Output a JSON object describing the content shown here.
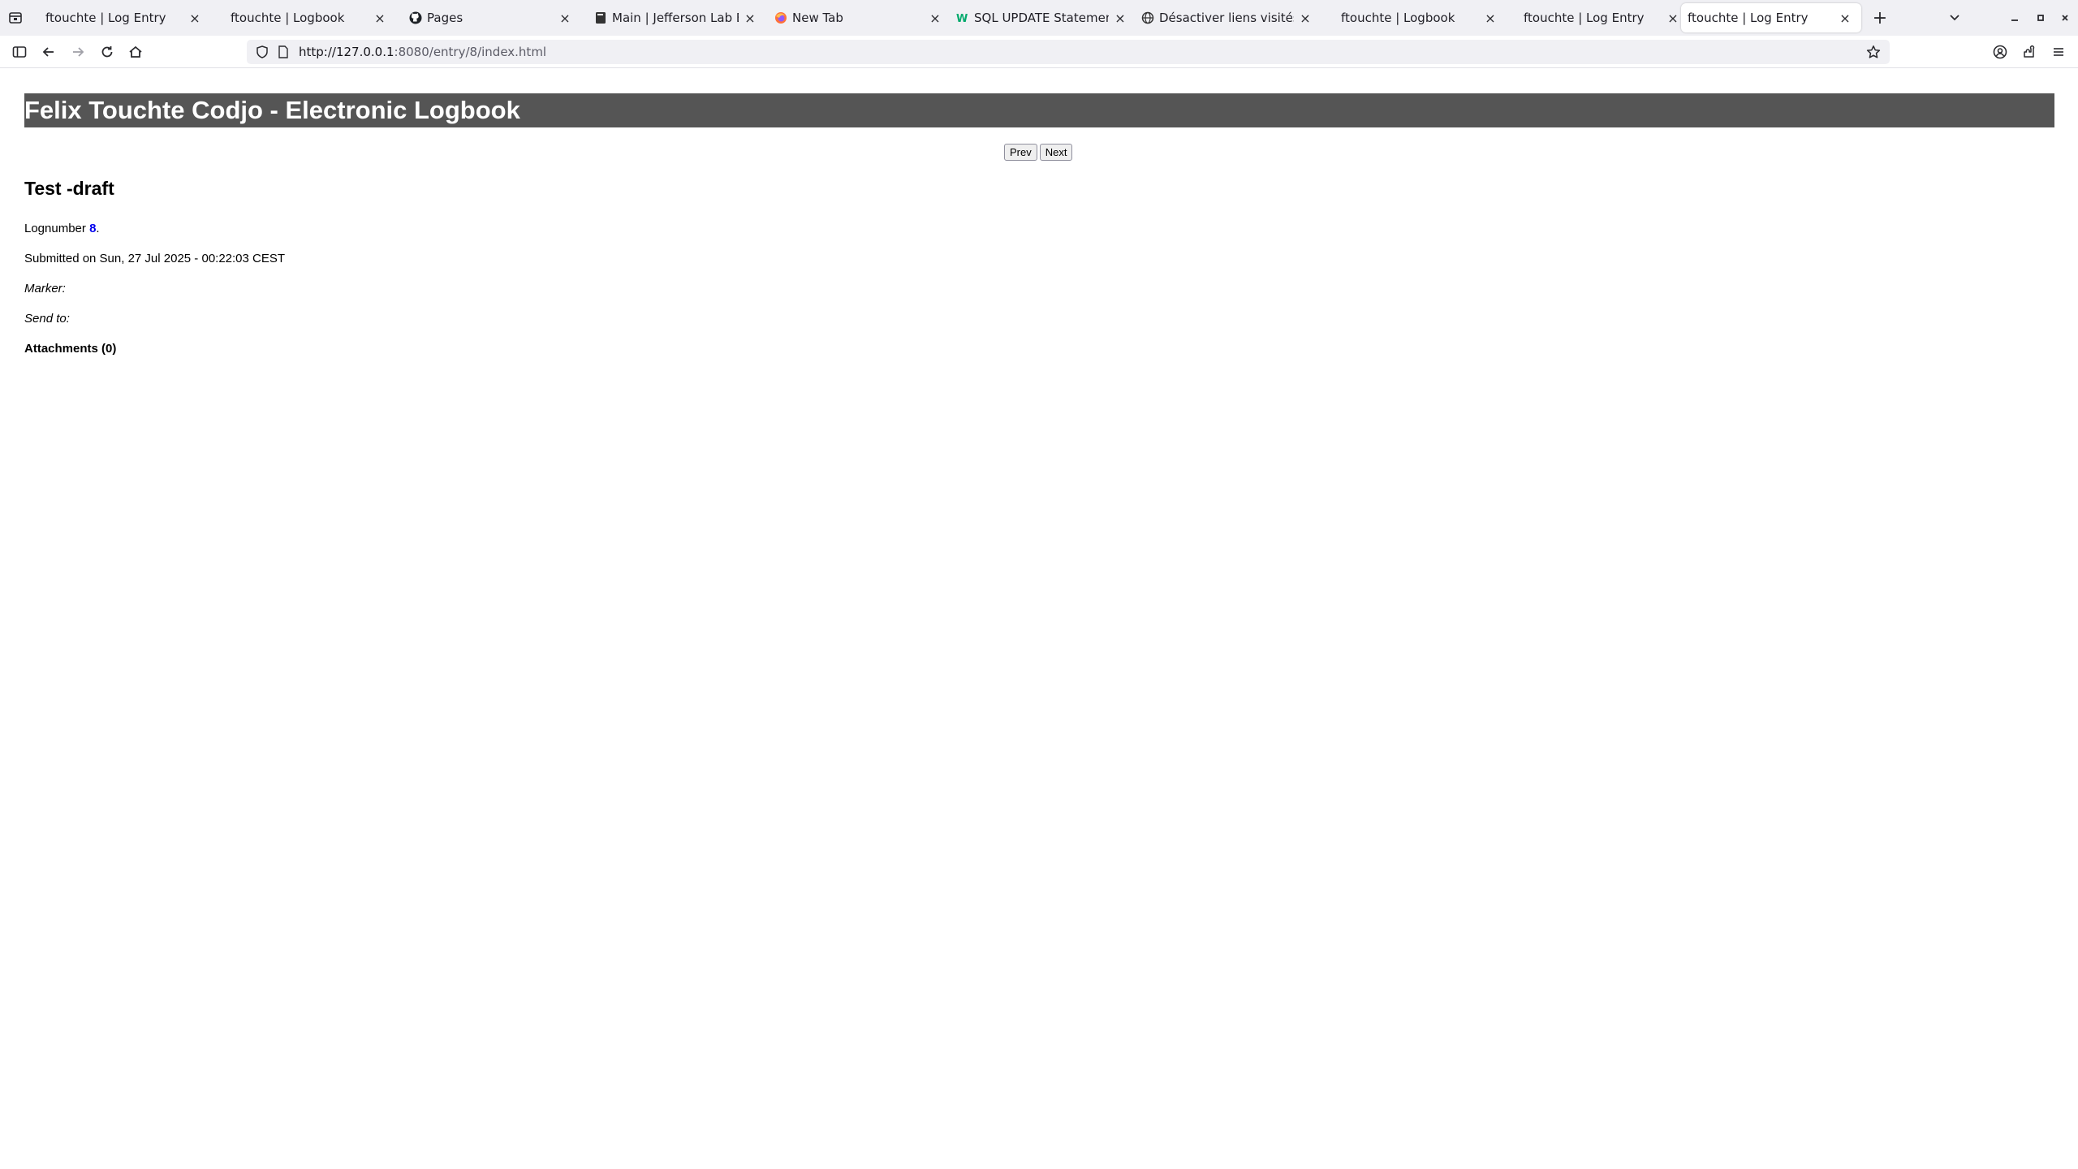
{
  "browser": {
    "tabs": [
      {
        "title": "ftouchte | Log Entry",
        "icon": "none"
      },
      {
        "title": "ftouchte | Logbook",
        "icon": "none"
      },
      {
        "title": "Pages",
        "icon": "github-icon"
      },
      {
        "title": "Main | Jefferson Lab Elec",
        "icon": "book-icon"
      },
      {
        "title": "New Tab",
        "icon": "firefox-icon"
      },
      {
        "title": "SQL UPDATE Statement",
        "icon": "w3schools-icon"
      },
      {
        "title": "Désactiver liens visités HT",
        "icon": "globe-icon"
      },
      {
        "title": "ftouchte | Logbook",
        "icon": "none"
      },
      {
        "title": "ftouchte | Log Entry",
        "icon": "none"
      },
      {
        "title": "ftouchte | Log Entry",
        "icon": "none",
        "active": true
      }
    ],
    "url_host": "http://127.0.0.1",
    "url_rest": ":8080/entry/8/index.html"
  },
  "page": {
    "banner": "Felix Touchte Codjo - Electronic Logbook",
    "prev_label": "Prev",
    "next_label": "Next",
    "entry_title": "Test -draft",
    "lognumber_label": "Lognumber",
    "lognumber_value": "8",
    "lognumber_suffix": ".",
    "submitted": "Submitted on Sun, 27 Jul 2025 - 00:22:03 CEST",
    "marker_label": "Marker:",
    "send_to_label": "Send to:",
    "attachments_label": "Attachments (0)"
  }
}
